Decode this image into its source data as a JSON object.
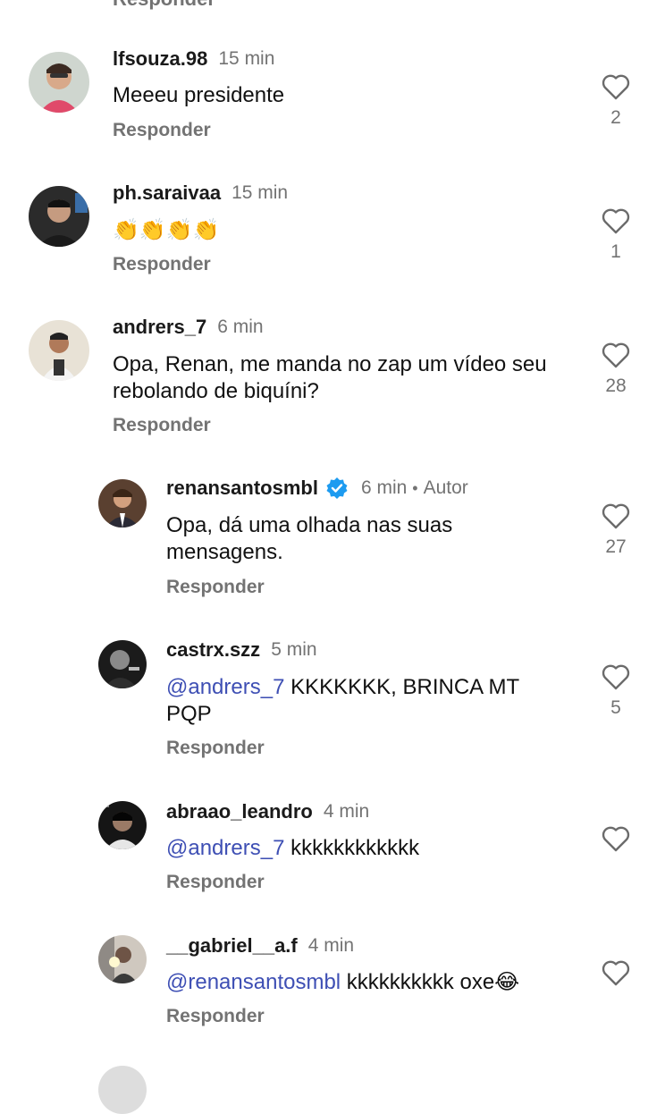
{
  "top_cut_text": "Responder",
  "reply_label": "Responder",
  "comments": [
    {
      "user": "lfsouza.98",
      "time": "15 min",
      "text": "Meeeu presidente",
      "likes": "2",
      "avatar": "person-avatar"
    },
    {
      "user": "ph.saraivaa",
      "time": "15 min",
      "text": "👏👏👏👏",
      "likes": "1",
      "avatar": "person-avatar"
    },
    {
      "user": "andrers_7",
      "time": "6 min",
      "text": "Opa, Renan, me manda no zap um vídeo seu rebolando de biquíni?",
      "likes": "28",
      "avatar": "person-avatar"
    },
    {
      "user": "renansantosmbl",
      "time": "6 min",
      "author_badge": "Autor",
      "verified": true,
      "text": "Opa, dá uma olhada nas suas mensagens.",
      "likes": "27",
      "avatar": "person-avatar"
    },
    {
      "user": "castrx.szz",
      "time": "5 min",
      "mention": "@andrers_7",
      "text": " KKKKKKK, BRINCA MT PQP",
      "likes": "5",
      "avatar": "person-avatar"
    },
    {
      "user": "abraao_leandro",
      "time": "4 min",
      "mention": "@andrers_7",
      "text": " kkkkkkkkkkkk",
      "likes": "",
      "avatar": "person-avatar"
    },
    {
      "user": "__gabriel__a.f",
      "time": "4 min",
      "mention": "@renansantosmbl",
      "text": " kkkkkkkkkk oxe😂",
      "likes": "",
      "avatar": "person-avatar"
    }
  ],
  "icons": {
    "like": "heart-outline-icon",
    "verified": "verified-badge-icon"
  },
  "colors": {
    "mention": "#3e4fb4",
    "muted": "#737373",
    "verified": "#1d9bf0"
  }
}
